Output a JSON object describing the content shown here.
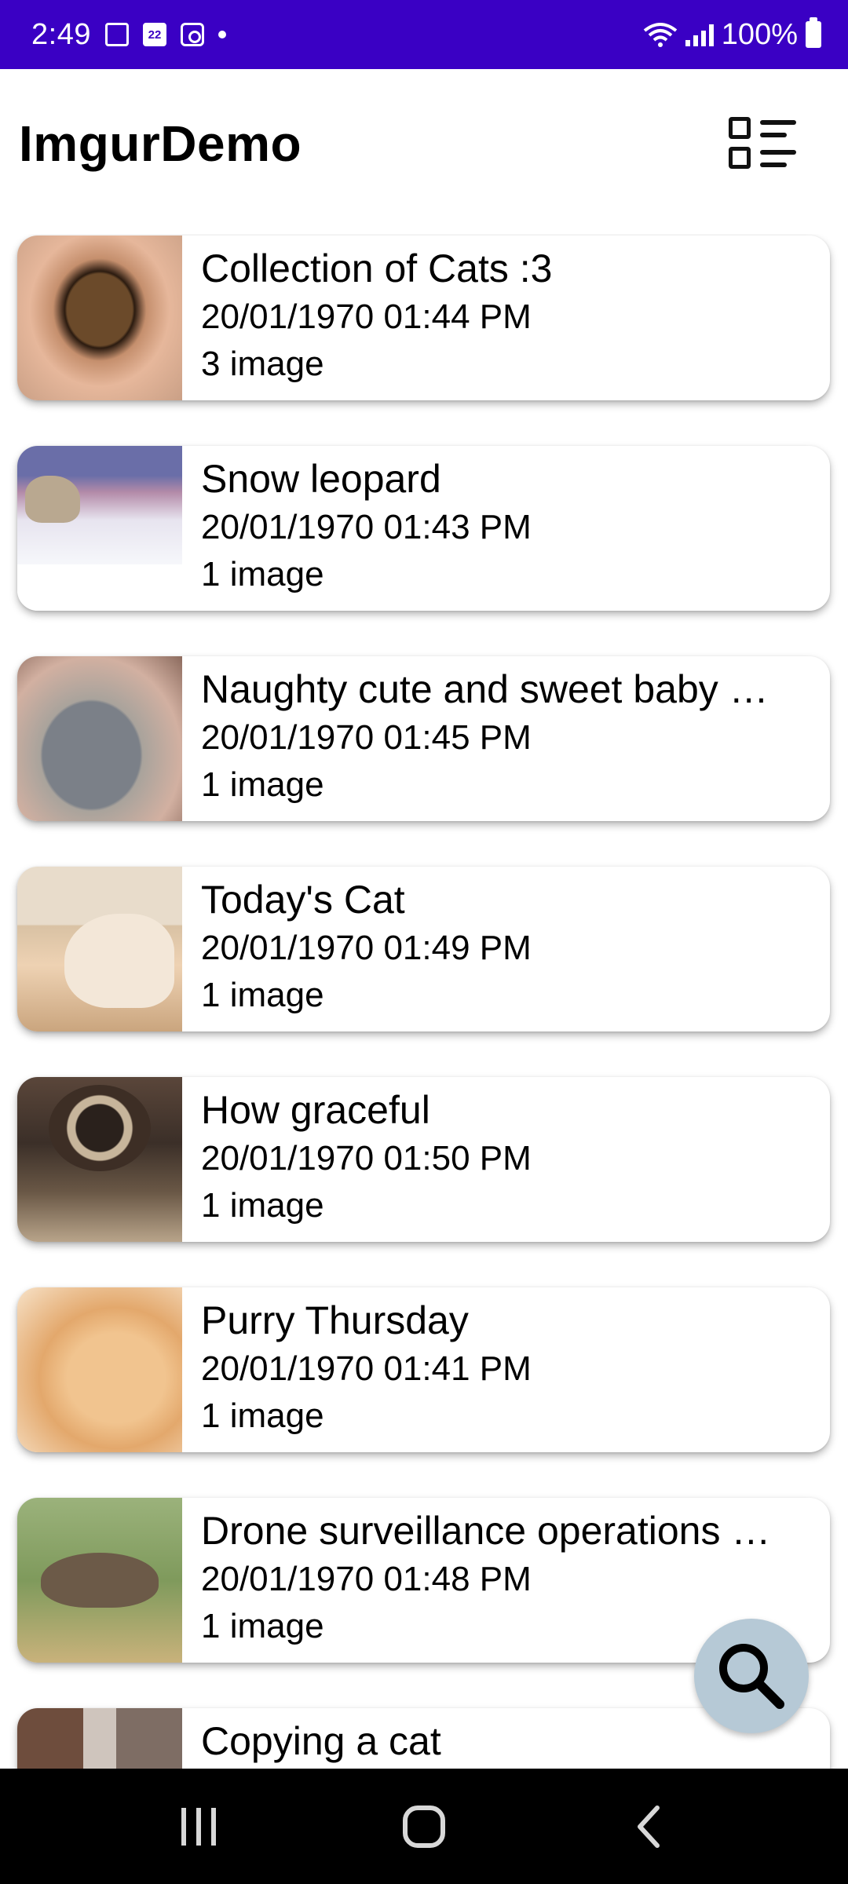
{
  "status_bar": {
    "time": "2:49",
    "calendar_day": "22",
    "battery": "100%",
    "icons": [
      "calendar-icon",
      "calendar-day-icon",
      "clock-icon",
      "notification-dot",
      "wifi-icon",
      "signal-icon",
      "battery-icon"
    ]
  },
  "app_bar": {
    "title": "ImgurDemo",
    "toggle_icon": "list-view-icon"
  },
  "gallery": {
    "items": [
      {
        "title": "Collection of Cats :3",
        "date": "20/01/1970 01:44 PM",
        "count": "3 image"
      },
      {
        "title": "Snow leopard",
        "date": "20/01/1970 01:43 PM",
        "count": "1 image"
      },
      {
        "title": "Naughty cute and sweet baby …",
        "date": "20/01/1970 01:45 PM",
        "count": "1 image"
      },
      {
        "title": "Today's Cat",
        "date": "20/01/1970 01:49 PM",
        "count": "1 image"
      },
      {
        "title": "How graceful",
        "date": "20/01/1970 01:50 PM",
        "count": "1 image"
      },
      {
        "title": "Purry Thursday",
        "date": "20/01/1970 01:41 PM",
        "count": "1 image"
      },
      {
        "title": "Drone surveillance operations …",
        "date": "20/01/1970 01:48 PM",
        "count": "1 image"
      },
      {
        "title": "Copying a cat",
        "date": "",
        "count": ""
      }
    ]
  },
  "fab": {
    "icon": "search-icon",
    "color": "#b6c9d6"
  },
  "nav_bar": {
    "buttons": [
      "recent-apps-icon",
      "home-icon",
      "back-icon"
    ]
  },
  "colors": {
    "status_bar": "#3a00c4",
    "nav_bar": "#000000",
    "card": "#ffffff"
  }
}
